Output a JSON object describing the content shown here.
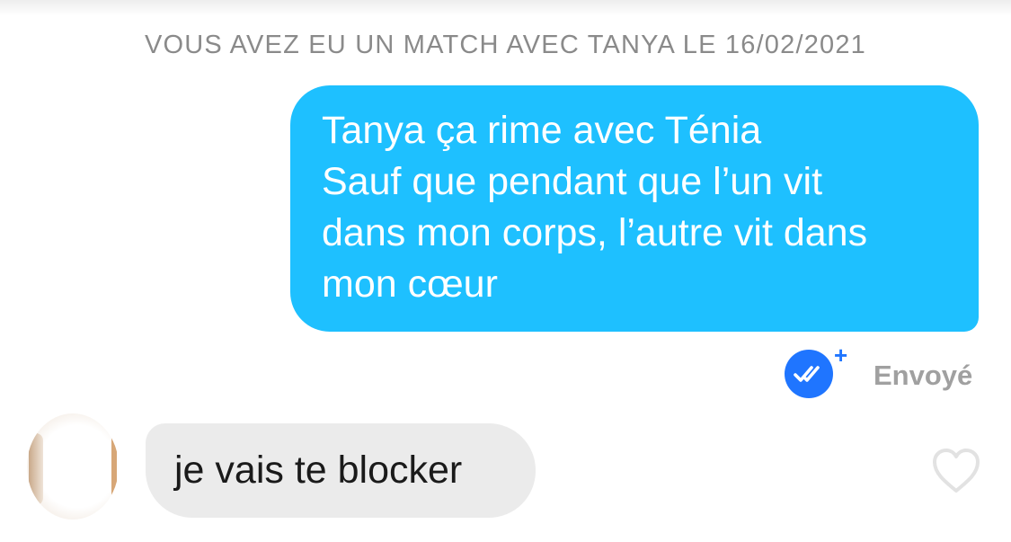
{
  "conversation": {
    "match_banner": "VOUS AVEZ EU UN MATCH AVEC TANYA LE 16/02/2021",
    "sent_message": {
      "lines": [
        "Tanya ça rime avec Ténia",
        "Sauf que pendant que l’un vit",
        "dans mon corps, l’autre vit dans",
        "mon cœur"
      ],
      "status": "Envoyé",
      "read_icon": "double-check-icon",
      "plus_icon": "plus-icon"
    },
    "received_message": {
      "text": "je vais te blocker",
      "like_icon": "heart-outline-icon"
    }
  },
  "colors": {
    "sent_bubble": "#1ec0ff",
    "received_bubble": "#ebebeb",
    "read_badge": "#1f75ff",
    "banner_text": "#8a8a8a",
    "status_text": "#a0a0a0",
    "heart_outline": "#e2e2e2"
  }
}
